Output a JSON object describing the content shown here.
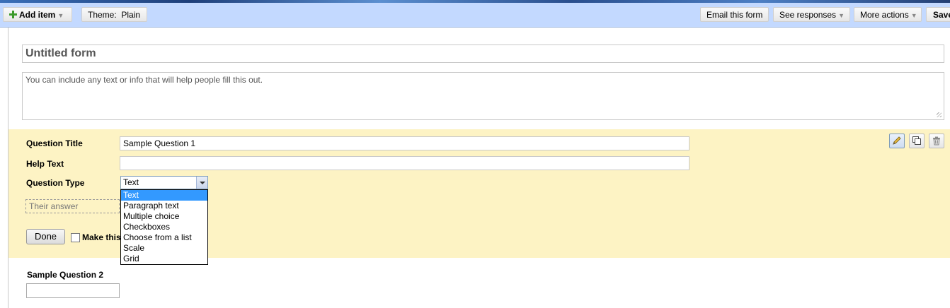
{
  "toolbar": {
    "add_item": "Add item",
    "theme": "Theme:  Plain",
    "email_form": "Email this form",
    "see_responses": "See responses",
    "more_actions": "More actions",
    "save": "Save"
  },
  "form": {
    "title": "Untitled form",
    "description_placeholder": "You can include any text or info that will help people fill this out."
  },
  "question_editor": {
    "title_label": "Question Title",
    "title_value": "Sample Question 1",
    "help_label": "Help Text",
    "help_value": "",
    "type_label": "Question Type",
    "type_value": "Text",
    "answer_placeholder": "Their answer",
    "done_label": "Done",
    "required_label": "Make this a required question"
  },
  "type_options": [
    "Text",
    "Paragraph text",
    "Multiple choice",
    "Checkboxes",
    "Choose from a list",
    "Scale",
    "Grid"
  ],
  "question2": {
    "title": "Sample Question 2"
  },
  "icons": [
    "plus-icon",
    "pencil-icon",
    "duplicate-icon",
    "trash-icon"
  ],
  "colors": {
    "toolbar_bg": "#c3d9ff",
    "editor_bg": "#fdf3c4",
    "selected_option": "#3399ff"
  }
}
